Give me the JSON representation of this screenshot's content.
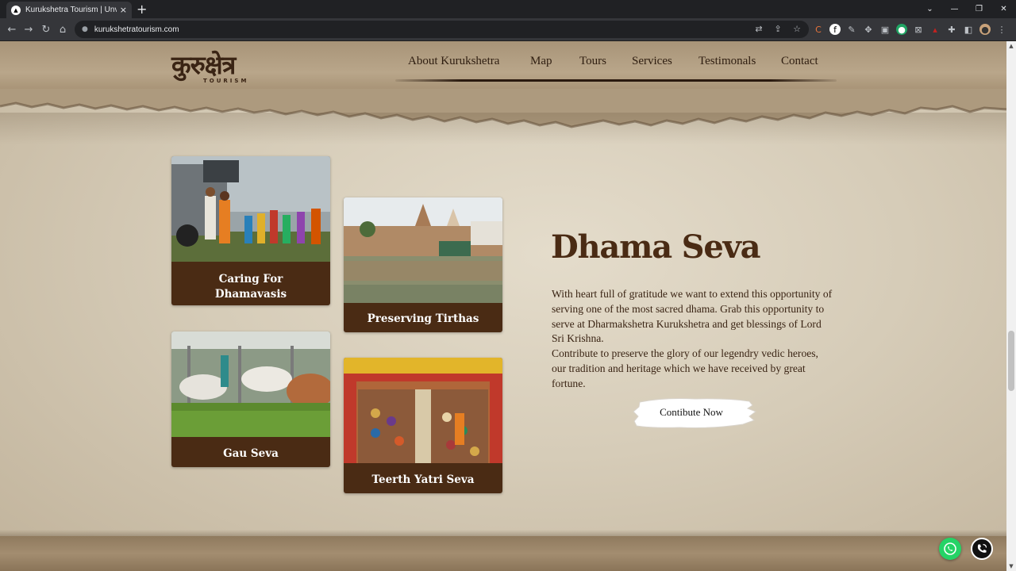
{
  "browser": {
    "tab_title": "Kurukshetra Tourism | Unveiling t",
    "tab_close": "×",
    "new_tab": "+",
    "url": "kurukshetratourism.com",
    "window_controls": [
      "⌄",
      "—",
      "❐",
      "✕"
    ]
  },
  "site": {
    "logo_text": "कुरुक्षेत्र",
    "logo_subtext": "TOURISM",
    "nav": [
      "About Kurukshetra",
      "Map",
      "Tours",
      "Services",
      "Testimonals",
      "Contact"
    ]
  },
  "cards": [
    {
      "label_lines": [
        "Caring For",
        "Dhamavasis"
      ]
    },
    {
      "label_lines": [
        "Preserving Tirthas"
      ]
    },
    {
      "label_lines": [
        "Gau Seva"
      ]
    },
    {
      "label_lines": [
        "Teerth Yatri Seva"
      ]
    }
  ],
  "section": {
    "title": "Dhama Seva",
    "paragraph_1": "With heart full of gratitude we want to extend this opportunity of serving one of the most sacred dhama. Grab this opportunity to serve at Dharmakshetra Kurukshetra and get blessings of Lord Sri Krishna.",
    "paragraph_2": "Contribute to preserve the glory of our legendry vedic heroes, our tradition and heritage which we have received by great fortune.",
    "button_label": "Contibute Now"
  },
  "colors": {
    "card_bg": "#4a2b14",
    "title": "#4a2b14",
    "paper": "#d6ccb8",
    "whatsapp": "#25d366"
  },
  "icons": {
    "floating": [
      "whatsapp-icon",
      "phone-call-icon"
    ]
  }
}
